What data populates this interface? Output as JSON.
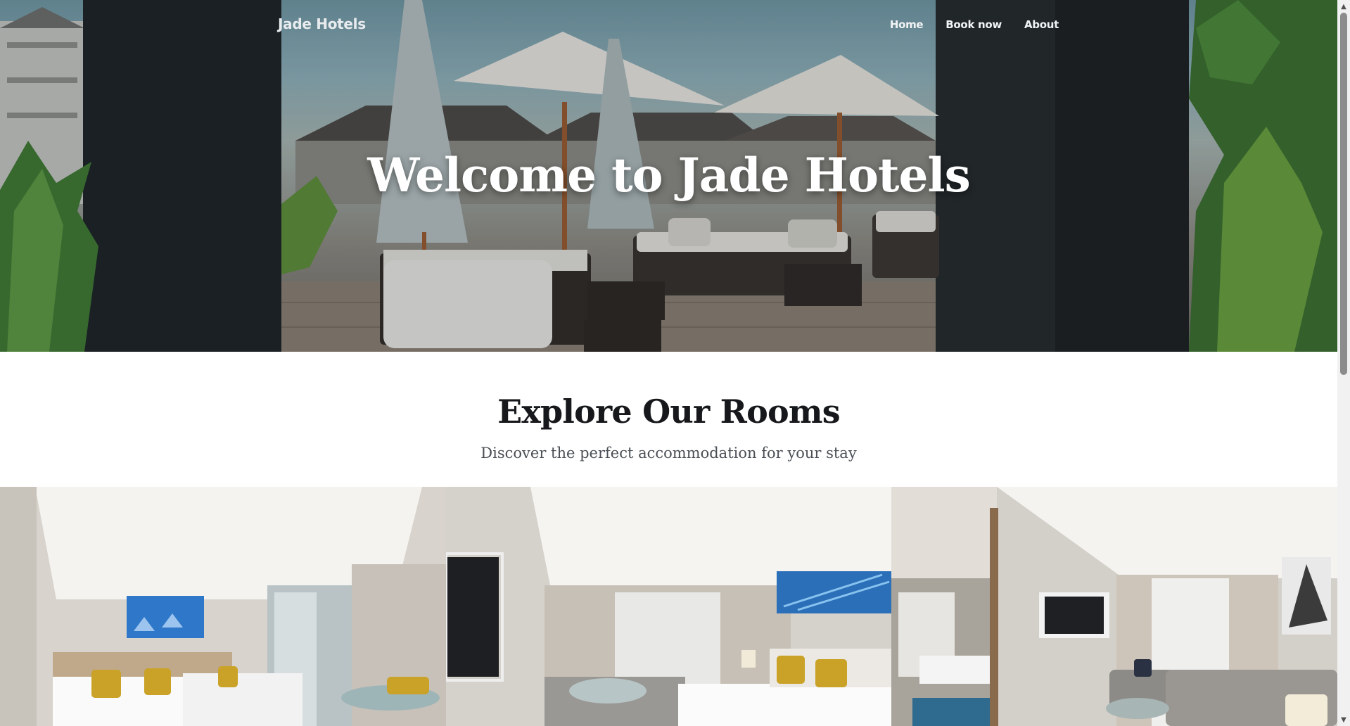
{
  "nav": {
    "brand": "Jade Hotels",
    "links": [
      "Home",
      "Book now",
      "About"
    ]
  },
  "hero": {
    "title": "Welcome to Jade Hotels"
  },
  "rooms": {
    "title": "Explore Our Rooms",
    "subtitle": "Discover the perfect accommodation for your stay"
  },
  "colors": {
    "hero_text": "#ffffff",
    "heading": "#16181b",
    "subtitle": "#4a4f55",
    "accent_blue": "#2f78c9",
    "pillow_gold": "#c9a227"
  }
}
